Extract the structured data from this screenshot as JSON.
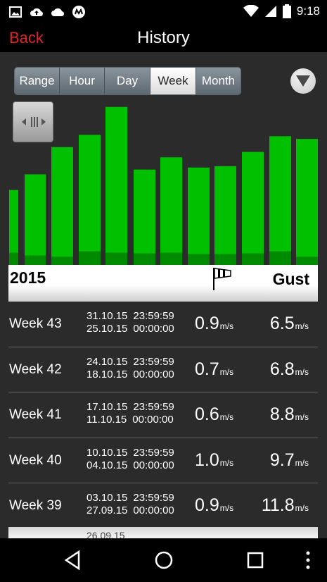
{
  "statusbar": {
    "time": "9:18"
  },
  "header": {
    "back_label": "Back",
    "title": "History"
  },
  "segments": [
    {
      "label": "Range",
      "active": false
    },
    {
      "label": "Hour",
      "active": false
    },
    {
      "label": "Day",
      "active": false
    },
    {
      "label": "Week",
      "active": true
    },
    {
      "label": "Month",
      "active": false
    }
  ],
  "chart_data": {
    "type": "bar",
    "colors": {
      "bar": "#00c000",
      "bar_dark": "#008a00"
    },
    "series": [
      {
        "values": [
          110,
          133,
          173,
          191,
          232,
          140,
          158,
          143,
          145,
          166,
          189,
          185
        ]
      },
      {
        "values": [
          18,
          14,
          12,
          20,
          18,
          17,
          18,
          16,
          16,
          17,
          20,
          12
        ]
      }
    ],
    "ylim": [
      0,
      240
    ]
  },
  "list_header": {
    "year": "2015",
    "gust_label": "Gust"
  },
  "rows": [
    {
      "week": "Week 43",
      "end_date": "31.10.15",
      "end_time": "23:59:59",
      "start_date": "25.10.15",
      "start_time": "00:00:00",
      "avg": "0.9",
      "avg_unit": "m/s",
      "gust": "6.5",
      "gust_unit": "m/s"
    },
    {
      "week": "Week 42",
      "end_date": "24.10.15",
      "end_time": "23:59:59",
      "start_date": "18.10.15",
      "start_time": "00:00:00",
      "avg": "0.7",
      "avg_unit": "m/s",
      "gust": "6.8",
      "gust_unit": "m/s"
    },
    {
      "week": "Week 41",
      "end_date": "17.10.15",
      "end_time": "23:59:59",
      "start_date": "11.10.15",
      "start_time": "00:00:00",
      "avg": "0.6",
      "avg_unit": "m/s",
      "gust": "8.8",
      "gust_unit": "m/s"
    },
    {
      "week": "Week 40",
      "end_date": "10.10.15",
      "end_time": "23:59:59",
      "start_date": "04.10.15",
      "start_time": "00:00:00",
      "avg": "1.0",
      "avg_unit": "m/s",
      "gust": "9.7",
      "gust_unit": "m/s"
    },
    {
      "week": "Week 39",
      "end_date": "03.10.15",
      "end_time": "23:59:59",
      "start_date": "27.09.15",
      "start_time": "00:00:00",
      "avg": "0.9",
      "avg_unit": "m/s",
      "gust": "11.8",
      "gust_unit": "m/s"
    }
  ],
  "next_peek": "26.09.15"
}
